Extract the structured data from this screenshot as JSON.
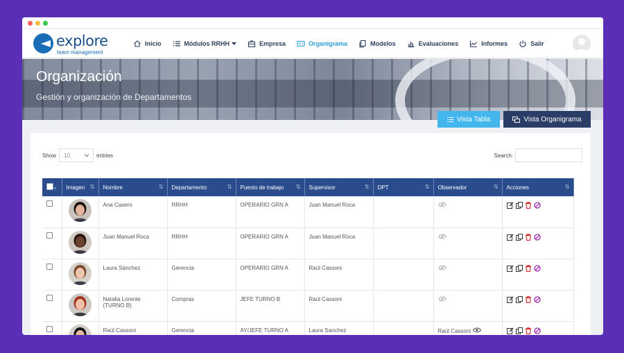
{
  "brand": {
    "name": "explore",
    "tagline": "team management"
  },
  "nav": [
    {
      "label": "Inicio",
      "icon": "home-icon",
      "active": false
    },
    {
      "label": "Módulos RRHH",
      "icon": "list-icon",
      "active": false,
      "dropdown": true
    },
    {
      "label": "Empresa",
      "icon": "briefcase-icon",
      "active": false
    },
    {
      "label": "Organigrama",
      "icon": "id-card-icon",
      "active": true
    },
    {
      "label": "Modelos",
      "icon": "copy-icon",
      "active": false
    },
    {
      "label": "Evaluaciones",
      "icon": "bar-chart-icon",
      "active": false
    },
    {
      "label": "Informes",
      "icon": "line-chart-icon",
      "active": false
    },
    {
      "label": "Salir",
      "icon": "power-icon",
      "active": false
    }
  ],
  "hero": {
    "title": "Organización",
    "subtitle": "Gestión y organización de Departamentos"
  },
  "buttons": {
    "table_view": "Vista Tabla",
    "org_view": "Vista Organigrama"
  },
  "table_controls": {
    "show": "Show",
    "entries_value": "10",
    "entries": "entries",
    "search": "Search:"
  },
  "columns": [
    "Imagen",
    "Nombre",
    "Departamento",
    "Puesto de trabajo",
    "Supervisor",
    "DPT",
    "Observador",
    "Acciones"
  ],
  "rows": [
    {
      "nombre": "Ana Casero",
      "departamento": "RRHH",
      "puesto": "OPERARIO GRN A",
      "supervisor": "Juan Manuel Roca",
      "dpt": "",
      "observador": ""
    },
    {
      "nombre": "Juan Manuel Roca",
      "departamento": "RRHH",
      "puesto": "OPERARIO GRN A",
      "supervisor": "Juan Manuel Roca",
      "dpt": "",
      "observador": ""
    },
    {
      "nombre": "Laura Sánchez",
      "departamento": "Gerencia",
      "puesto": "OPERARIO GRN A",
      "supervisor": "Raúl Cassoni",
      "dpt": "",
      "observador": ""
    },
    {
      "nombre": "Natalia Lorente (TURNO B)",
      "departamento": "Compras",
      "puesto": "JEFE TURNO B",
      "supervisor": "Raúl Cassoni",
      "dpt": "",
      "observador": ""
    },
    {
      "nombre": "Raúl Cassoni",
      "departamento": "Gerencia",
      "puesto": "AY/JEFE TURNO A",
      "supervisor": "Laura Sanchez",
      "dpt": "",
      "observador": "Raúl Cassoni"
    }
  ],
  "colors": {
    "accent": "#2e9fd7",
    "table_header": "#2b4c8c",
    "btn_table": "#43b6ee",
    "btn_org": "#2a3d66",
    "background": "#5b2fb5"
  }
}
